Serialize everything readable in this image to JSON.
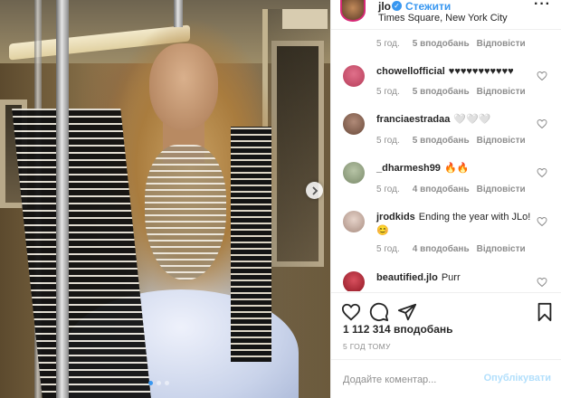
{
  "header": {
    "username": "jlo",
    "follow_label": "Стежити",
    "location": "Times Square, New York City",
    "more_icon": "more-horizontal-icon"
  },
  "top_meta": {
    "time": "5 год.",
    "likes": "5 вподобань",
    "reply": "Відповісти"
  },
  "comments": [
    {
      "username": "chowellofficial",
      "text": "♥♥♥♥♥♥♥♥♥♥♥",
      "time": "5 год.",
      "likes": "5 вподобань",
      "reply": "Відповісти",
      "avatar_color": "#b63d5a"
    },
    {
      "username": "franciaestradaa",
      "text": "🤍🤍🤍",
      "time": "5 год.",
      "likes": "5 вподобань",
      "reply": "Відповісти",
      "avatar_color": "#7a5a4a"
    },
    {
      "username": "_dharmesh99",
      "text": "🔥🔥",
      "time": "5 год.",
      "likes": "4 вподобань",
      "reply": "Відповісти",
      "avatar_color": "#8a9a7a"
    },
    {
      "username": "jrodkids",
      "text": "Ending the year with JLo! 😊",
      "time": "5 год.",
      "likes": "4 вподобань",
      "reply": "Відповісти",
      "avatar_color": "#c9b2a8"
    },
    {
      "username": "beautified.jlo",
      "text": "Purr",
      "time": "",
      "likes": "",
      "reply": "",
      "avatar_color": "#9e1e2a"
    }
  ],
  "post": {
    "likes_count": "1 112 314 вподобань",
    "time": "5 ГОД ТОМУ"
  },
  "add_comment": {
    "placeholder": "Додайте коментар...",
    "post_label": "Опублікувати"
  },
  "colors": {
    "accent": "#3897f0",
    "muted": "#8e8e8e",
    "post_disabled": "#b2dffc"
  },
  "carousel": {
    "total": 3,
    "active": 0
  }
}
